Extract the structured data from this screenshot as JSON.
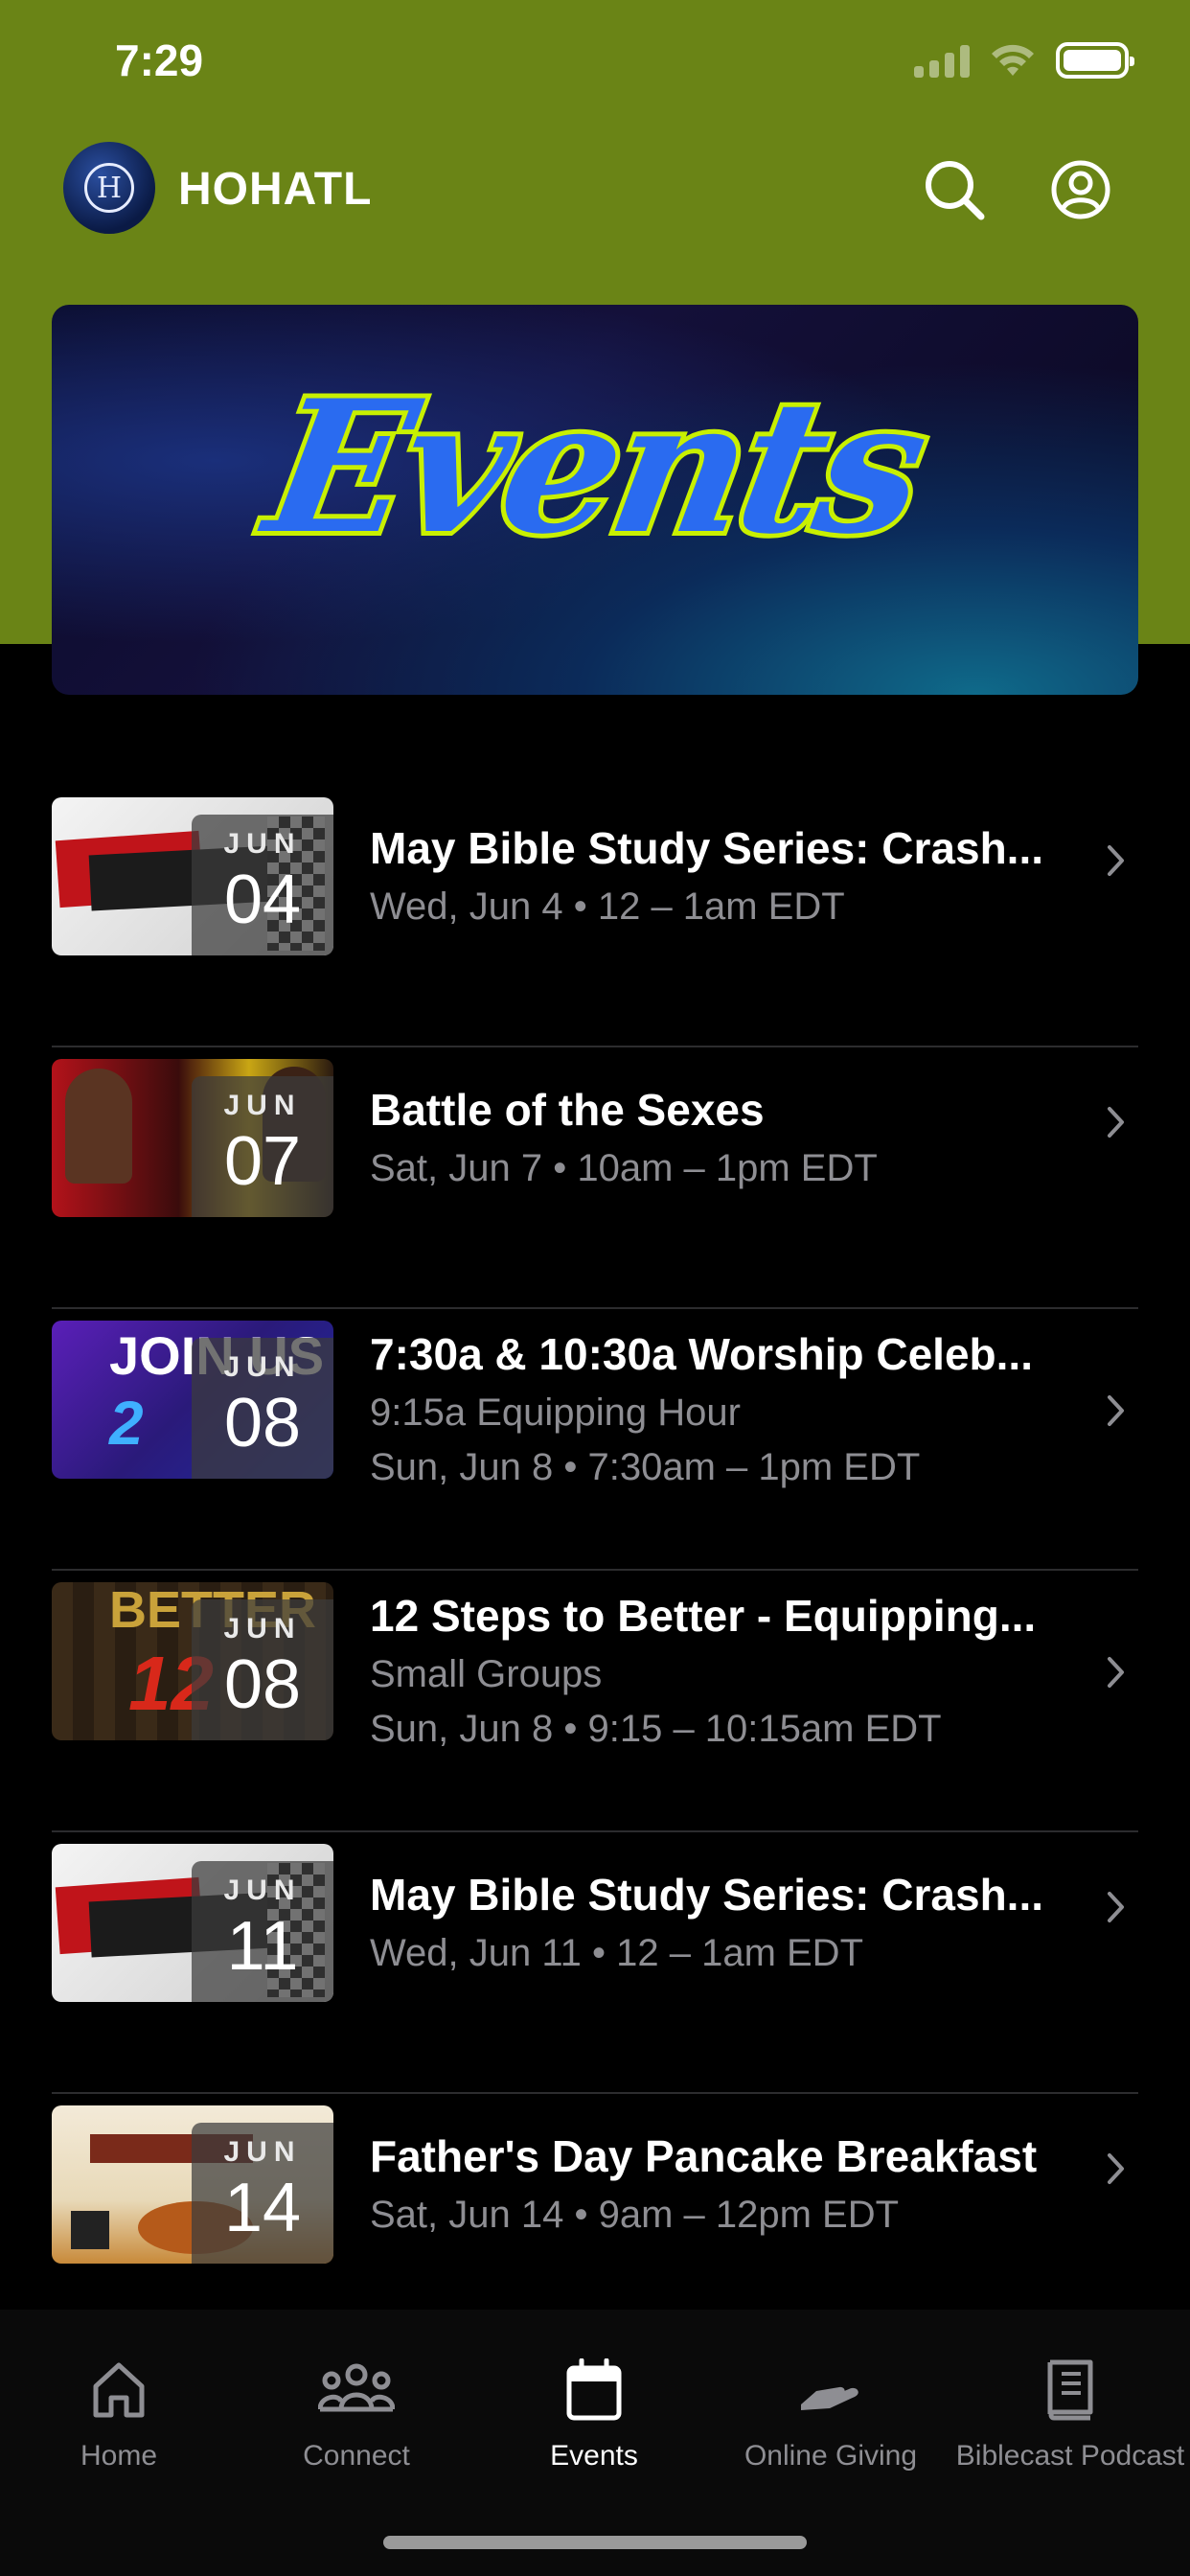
{
  "status": {
    "time": "7:29"
  },
  "header": {
    "app_name": "HOHATL",
    "logo_letter": "H"
  },
  "hero": {
    "title": "Events"
  },
  "events": [
    {
      "title": "May Bible Study Series: Crash...",
      "subtitle": "",
      "date": "Wed, Jun 4 • 12 – 1am EDT",
      "month": "JUN",
      "day": "04",
      "thumb": "crashing-out"
    },
    {
      "title": "Battle of the Sexes",
      "subtitle": "",
      "date": "Sat, Jun 7 • 10am – 1pm EDT",
      "month": "JUN",
      "day": "07",
      "thumb": "battle"
    },
    {
      "title": "7:30a & 10:30a Worship Celeb...",
      "subtitle": "9:15a Equipping Hour",
      "date": "Sun, Jun 8 • 7:30am – 1pm EDT",
      "month": "JUN",
      "day": "08",
      "thumb": "join-us"
    },
    {
      "title": "12 Steps to Better - Equipping...",
      "subtitle": "Small Groups",
      "date": "Sun, Jun 8 • 9:15 – 10:15am EDT",
      "month": "JUN",
      "day": "08",
      "thumb": "better"
    },
    {
      "title": "May Bible Study Series: Crash...",
      "subtitle": "",
      "date": "Wed, Jun 11 • 12 – 1am EDT",
      "month": "JUN",
      "day": "11",
      "thumb": "crashing-out"
    },
    {
      "title": "Father's Day Pancake Breakfast",
      "subtitle": "",
      "date": "Sat, Jun 14 • 9am – 12pm EDT",
      "month": "JUN",
      "day": "14",
      "thumb": "pancake"
    }
  ],
  "tabs": [
    {
      "label": "Home",
      "icon": "home-icon",
      "active": false
    },
    {
      "label": "Connect",
      "icon": "people-icon",
      "active": false
    },
    {
      "label": "Events",
      "icon": "calendar-icon",
      "active": true
    },
    {
      "label": "Online Giving",
      "icon": "giving-hand-icon",
      "active": false
    },
    {
      "label": "Biblecast Podcast",
      "icon": "book-icon",
      "active": false
    }
  ],
  "colors": {
    "header_green": "#6a8416",
    "accent_lime": "#c8f000",
    "muted_text": "#8e8e93"
  }
}
